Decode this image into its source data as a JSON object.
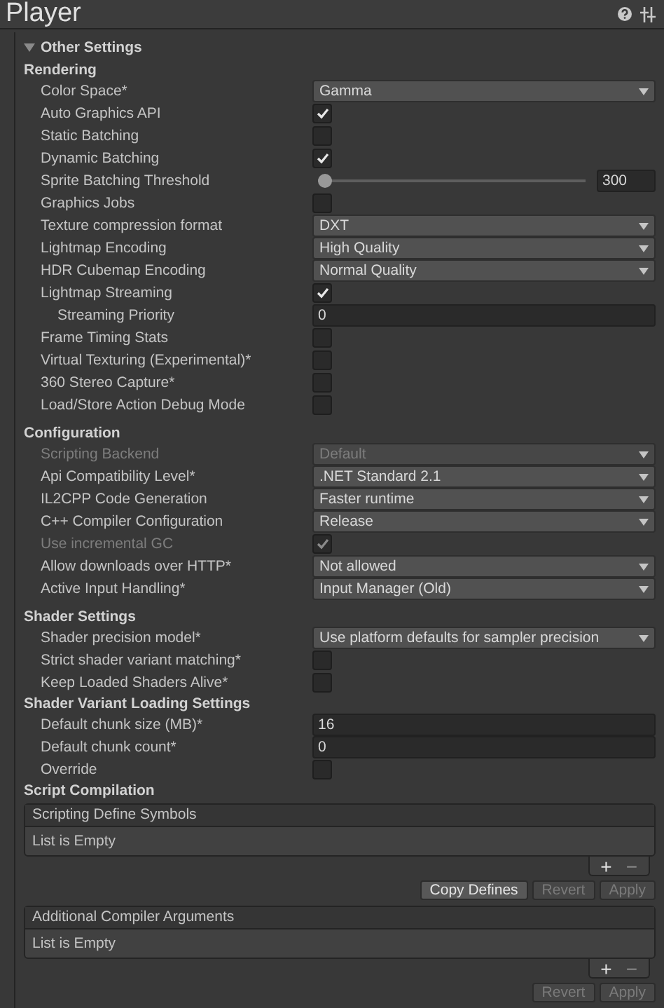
{
  "window": {
    "title": "Player"
  },
  "foldout": {
    "title": "Other Settings",
    "expanded": true
  },
  "sections": [
    {
      "title": "Rendering",
      "rows": [
        {
          "label": "Color Space*",
          "kind": "dropdown",
          "value": "Gamma",
          "disabled": false
        },
        {
          "label": "Auto Graphics API",
          "kind": "checkbox",
          "checked": true,
          "disabled": false
        },
        {
          "label": "Static Batching",
          "kind": "checkbox",
          "checked": false,
          "disabled": false
        },
        {
          "label": "Dynamic Batching",
          "kind": "checkbox",
          "checked": true,
          "disabled": false
        },
        {
          "label": "Sprite Batching Threshold",
          "kind": "slider",
          "level": 0,
          "value": "300",
          "disabled": false
        },
        {
          "label": "Graphics Jobs",
          "kind": "checkbox",
          "checked": false,
          "disabled": false
        },
        {
          "label": "Texture compression format",
          "kind": "dropdown",
          "value": "DXT",
          "disabled": false
        },
        {
          "label": "Lightmap Encoding",
          "kind": "dropdown",
          "value": "High Quality",
          "disabled": false
        },
        {
          "label": "HDR Cubemap Encoding",
          "kind": "dropdown",
          "value": "Normal Quality",
          "disabled": false
        },
        {
          "label": "Lightmap Streaming",
          "kind": "checkbox",
          "checked": true,
          "disabled": false,
          "children": [
            {
              "label": "Streaming Priority",
              "kind": "number",
              "value": "0",
              "disabled": false
            }
          ]
        },
        {
          "label": "Frame Timing Stats",
          "kind": "checkbox",
          "checked": false,
          "disabled": false
        },
        {
          "label": "Virtual Texturing (Experimental)*",
          "kind": "checkbox",
          "checked": false,
          "disabled": false
        },
        {
          "label": "360 Stereo Capture*",
          "kind": "checkbox",
          "checked": false,
          "disabled": false
        },
        {
          "label": "Load/Store Action Debug Mode",
          "kind": "checkbox",
          "checked": false,
          "disabled": false
        }
      ]
    },
    {
      "title": "Configuration",
      "rows": [
        {
          "label": "Scripting Backend",
          "kind": "dropdown",
          "value": "Default",
          "disabled": true
        },
        {
          "label": "Api Compatibility Level*",
          "kind": "dropdown",
          "value": ".NET Standard 2.1",
          "disabled": false
        },
        {
          "label": "IL2CPP Code Generation",
          "kind": "dropdown",
          "value": "Faster runtime",
          "disabled": false
        },
        {
          "label": "C++ Compiler Configuration",
          "kind": "dropdown",
          "value": "Release",
          "disabled": false
        },
        {
          "label": "Use incremental GC",
          "kind": "checkbox",
          "checked": true,
          "disabled": true
        },
        {
          "label": "Allow downloads over HTTP*",
          "kind": "dropdown",
          "value": "Not allowed",
          "disabled": false
        },
        {
          "label": "Active Input Handling*",
          "kind": "dropdown",
          "value": "Input Manager (Old)",
          "disabled": false
        }
      ]
    },
    {
      "title": "Shader Settings",
      "rows": [
        {
          "label": "Shader precision model*",
          "kind": "dropdown",
          "value": "Use platform defaults for sampler precision",
          "disabled": false
        },
        {
          "label": "Strict shader variant matching*",
          "kind": "checkbox",
          "checked": false,
          "disabled": false
        },
        {
          "label": "Keep Loaded Shaders Alive*",
          "kind": "checkbox",
          "checked": false,
          "disabled": false
        }
      ]
    },
    {
      "title": "Shader Variant Loading Settings",
      "rows": [
        {
          "label": "Default chunk size (MB)*",
          "kind": "number",
          "value": "16",
          "disabled": false
        },
        {
          "label": "Default chunk count*",
          "kind": "number",
          "value": "0",
          "disabled": false
        },
        {
          "label": "Override",
          "kind": "checkbox",
          "checked": false,
          "disabled": false
        }
      ]
    },
    {
      "title": "Script Compilation",
      "lists": [
        {
          "title": "Scripting Define Symbols",
          "empty_text": "List is Empty",
          "add": "+",
          "remove": "−",
          "buttons": [
            {
              "label": "Copy Defines",
              "disabled": false
            },
            {
              "label": "Revert",
              "disabled": true
            },
            {
              "label": "Apply",
              "disabled": true
            }
          ]
        },
        {
          "title": "Additional Compiler Arguments",
          "empty_text": "List is Empty",
          "add": "+",
          "remove": "−",
          "buttons": [
            {
              "label": "Revert",
              "disabled": true
            },
            {
              "label": "Apply",
              "disabled": true
            }
          ]
        }
      ]
    }
  ]
}
